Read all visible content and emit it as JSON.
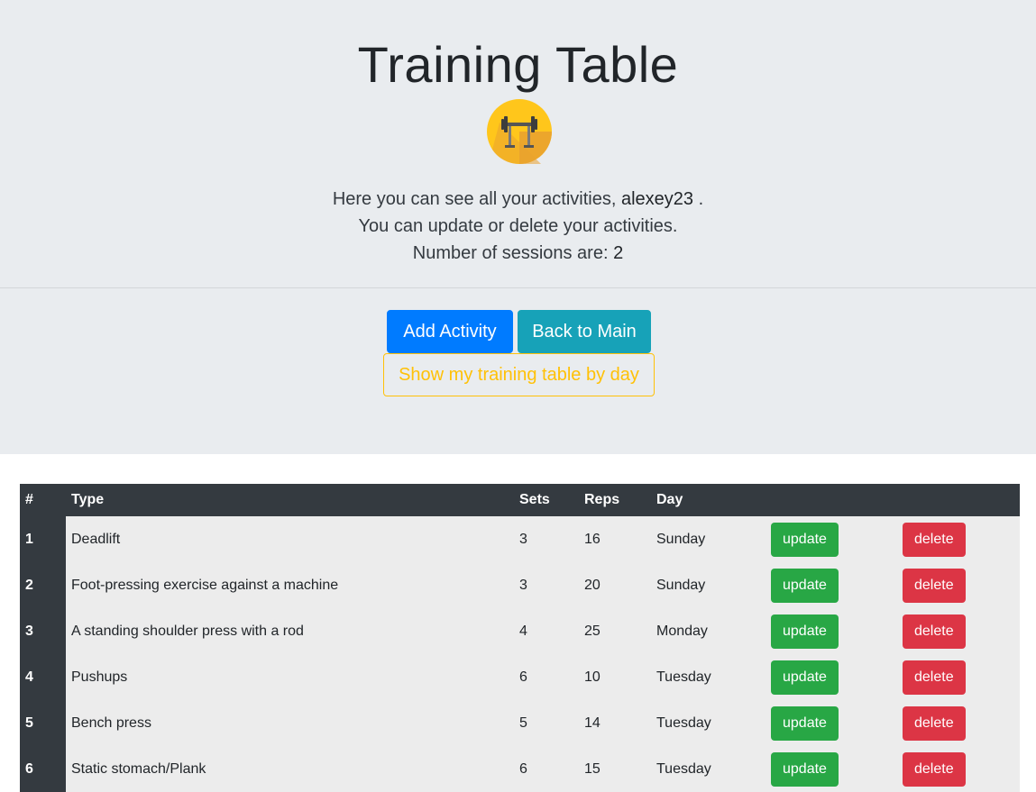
{
  "header": {
    "title": "Training Table",
    "intro_prefix": "Here you can see all your activities,",
    "username": "alexey23",
    "intro_suffix": ".",
    "line2": "You can update or delete your activities.",
    "sessions_prefix": "Number of sessions are:",
    "sessions_count": "2"
  },
  "actions": {
    "add_label": "Add Activity",
    "back_label": "Back to Main",
    "by_day_label": "Show my training table by day"
  },
  "table": {
    "columns": [
      "#",
      "Type",
      "Sets",
      "Reps",
      "Day",
      "",
      ""
    ],
    "rows": [
      {
        "num": "1",
        "type": "Deadlift",
        "sets": "3",
        "reps": "16",
        "day": "Sunday",
        "update": "update",
        "delete": "delete"
      },
      {
        "num": "2",
        "type": "Foot-pressing exercise against a machine",
        "sets": "3",
        "reps": "20",
        "day": "Sunday",
        "update": "update",
        "delete": "delete"
      },
      {
        "num": "3",
        "type": "A standing shoulder press with a rod",
        "sets": "4",
        "reps": "25",
        "day": "Monday",
        "update": "update",
        "delete": "delete"
      },
      {
        "num": "4",
        "type": "Pushups",
        "sets": "6",
        "reps": "10",
        "day": "Tuesday",
        "update": "update",
        "delete": "delete"
      },
      {
        "num": "5",
        "type": "Bench press",
        "sets": "5",
        "reps": "14",
        "day": "Tuesday",
        "update": "update",
        "delete": "delete"
      },
      {
        "num": "6",
        "type": "Static stomach/Plank",
        "sets": "6",
        "reps": "15",
        "day": "Tuesday",
        "update": "update",
        "delete": "delete"
      }
    ]
  },
  "colors": {
    "primary": "#007bff",
    "info": "#17a2b8",
    "warning": "#ffc107",
    "success": "#28a745",
    "danger": "#dc3545",
    "dark": "#343a40"
  },
  "icons": {
    "logo": "barbell-rack-icon"
  }
}
